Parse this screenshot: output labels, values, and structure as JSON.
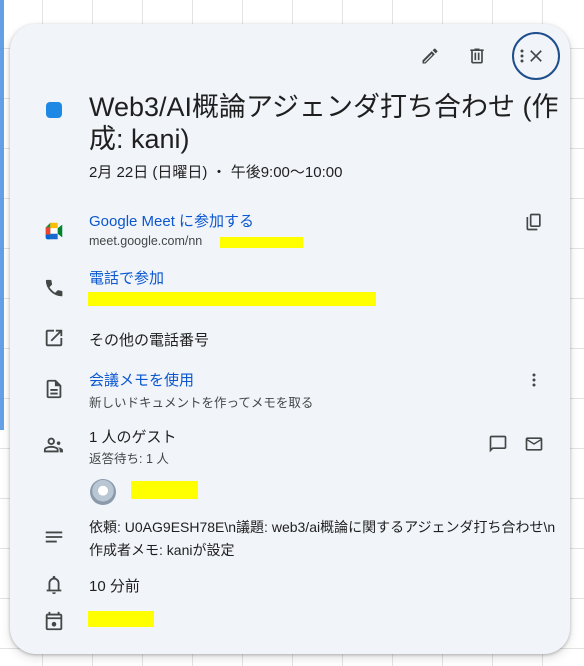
{
  "event": {
    "title": "Web3/AI概論アジェンダ打ち合わせ (作成: kani)",
    "date": "2月 22日 (日曜日) ・ 午後9:00～10:00",
    "color": "#1e88e5"
  },
  "meet": {
    "join_label": "Google Meet に参加する",
    "url": "meet.google.com/nn"
  },
  "phone": {
    "join_label": "電話で参加",
    "more_numbers": "その他の電話番号"
  },
  "notes": {
    "label": "会議メモを使用",
    "sub": "新しいドキュメントを作ってメモを取る"
  },
  "guests": {
    "count": "1 人のゲスト",
    "status": "返答待ち: 1 人"
  },
  "description": "依頼: U0AG9ESH78E\\n議題: web3/ai概論に関するアジェンダ打ち合わせ\\n作成者メモ: kaniが設定",
  "reminder": "10 分前",
  "icons": {
    "edit": "pencil-icon",
    "delete": "trash-icon",
    "more": "more-vert-icon",
    "close": "close-icon",
    "meet": "google-meet-icon",
    "copy": "copy-icon",
    "phone": "phone-icon",
    "external": "open-in-new-icon",
    "doc": "document-icon",
    "people": "people-icon",
    "chat": "chat-icon",
    "mail": "mail-icon",
    "notes": "description-icon",
    "bell": "bell-icon",
    "calendar": "calendar-icon"
  }
}
